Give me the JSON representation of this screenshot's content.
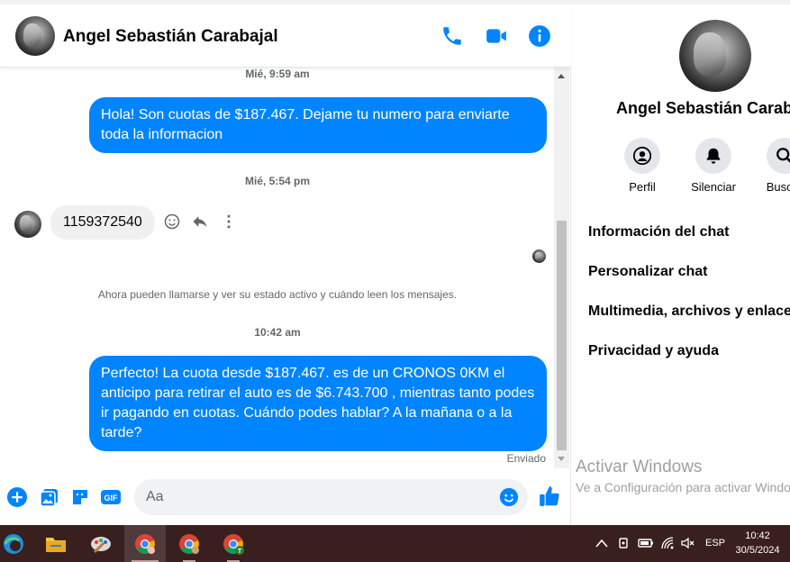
{
  "chat": {
    "contact_name": "Angel Sebastián Carabajal",
    "messages": [
      {
        "timestamp": "Mié, 9:59 am"
      },
      {
        "from": "me",
        "text": "Hola! Son cuotas de $187.467. Dejame tu numero para enviarte toda la informacion"
      },
      {
        "timestamp": "Mié, 5:54 pm"
      },
      {
        "from": "contact",
        "text": "1159372540"
      },
      {
        "system": "Ahora pueden llamarse y ver su estado activo y cuándo leen los mensajes."
      },
      {
        "timestamp": "10:42 am"
      },
      {
        "from": "me",
        "text": "Perfecto! La cuota desde $187.467. es de un CRONOS 0KM el anticipo para retirar el auto es de $6.743.700 , mientras tanto podes ir pagando en cuotas. Cuándo podes hablar? A la mañana o a la tarde?"
      }
    ],
    "status": "Enviado",
    "composer": {
      "placeholder": "Aa"
    },
    "accent_color": "#0084ff"
  },
  "info_panel": {
    "name": "Angel Sebastián Carabajal",
    "actions": [
      {
        "label": "Perfil",
        "icon": "profile-icon"
      },
      {
        "label": "Silenciar",
        "icon": "bell-icon"
      },
      {
        "label": "Buscar",
        "icon": "search-icon"
      }
    ],
    "menu": [
      "Información del chat",
      "Personalizar chat",
      "Multimedia, archivos y enlaces",
      "Privacidad y ayuda"
    ]
  },
  "watermark": {
    "title": "Activar Windows",
    "subtitle": "Ve a Configuración para activar Windows."
  },
  "taskbar": {
    "language": "ESP",
    "time": "10:42",
    "date": "30/5/2024"
  }
}
